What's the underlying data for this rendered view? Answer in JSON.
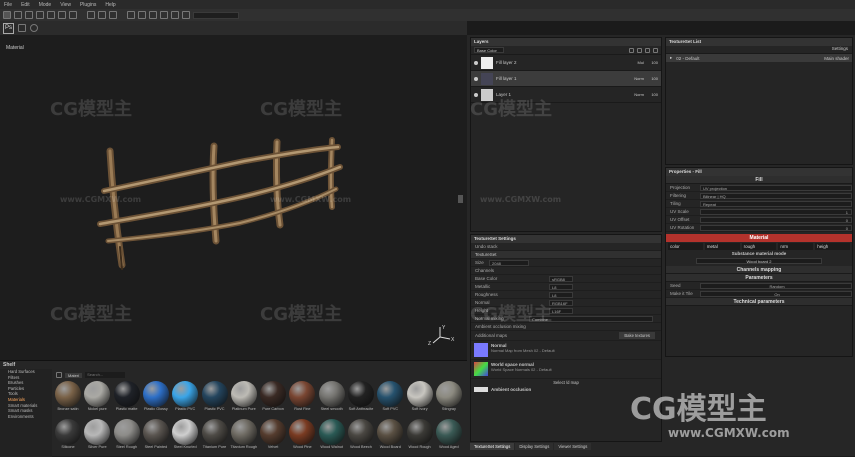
{
  "menu": [
    "File",
    "Edit",
    "Mode",
    "View",
    "Plugins",
    "Help"
  ],
  "viewport": {
    "label": "Material"
  },
  "layers": {
    "title": "Layers",
    "dropdown": "Base Color",
    "items": [
      {
        "name": "Fill layer 2",
        "blend": "Mul",
        "opacity": "100"
      },
      {
        "name": "Fill layer 1",
        "blend": "Norm",
        "opacity": "100"
      },
      {
        "name": "Layer 1",
        "blend": "Norm",
        "opacity": "100"
      }
    ]
  },
  "textureset_list": {
    "title": "TextureSet List",
    "settings": "Settings",
    "item": "02 - Default",
    "shader": "Main shader"
  },
  "properties": {
    "title": "Properties - Fill",
    "fill": "Fill",
    "projection_label": "Projection",
    "projection_value": "UV projection",
    "filtering_label": "Filtering",
    "filtering_value": "Bilinear | HQ",
    "tiling_label": "Tiling",
    "tiling_value": "Repeat",
    "uvscale_label": "UV Scale",
    "uvscale_value": "1",
    "uvoffset_label": "UV Offset",
    "uvoffset_value": "0",
    "uvrot_label": "UV Rotation",
    "uvrot_value": "0",
    "material": "Material",
    "channels": [
      "color",
      "metal",
      "rough",
      "nrm",
      "heigh"
    ],
    "mode_title": "Substance material mode",
    "mode_value": "Wood board 2",
    "mapping": "Channels mapping",
    "parameters": "Parameters",
    "param1_label": "Seed",
    "param1_value": "Random",
    "param2_label": "Make it Tile",
    "param2_value": "On",
    "technical": "Technical parameters"
  },
  "textureset_settings": {
    "title": "TextureSet Settings",
    "undo": "Undo stack",
    "name": "TextureSet",
    "size_label": "Size",
    "size_value": "2048",
    "channels_label": "Channels",
    "channels": [
      {
        "name": "Base Color",
        "fmt": "sRGB8"
      },
      {
        "name": "Metallic",
        "fmt": "L8"
      },
      {
        "name": "Roughness",
        "fmt": "L8"
      },
      {
        "name": "Normal",
        "fmt": "RGB16F"
      },
      {
        "name": "Height",
        "fmt": "L16F"
      }
    ],
    "normal_mixing_label": "Normal mixing",
    "normal_mixing_value": "Combine",
    "ao_label": "Ambient occlusion mixing",
    "maps_label": "Additional maps",
    "bake_button": "Bake textures",
    "maps": [
      {
        "title": "Normal",
        "sub": "Normal Map from Mesh 02 - Default"
      },
      {
        "title": "World space normal",
        "sub": "World Space Normals 02 - Default"
      },
      {
        "title": "Ambient occlusion",
        "sub": ""
      }
    ],
    "select_map": "Select /d map"
  },
  "bottom_tabs": [
    "TextureSet Settings",
    "Display Settings",
    "Viewer Settings"
  ],
  "shelf": {
    "title": "Shelf",
    "categories": [
      "Hard Surfaces",
      "Filters",
      "Brushes",
      "Particles",
      "Tools",
      "Materials",
      "Smart materials",
      "Smart masks",
      "Environments"
    ],
    "selected": "Materials",
    "filter_tag": "Materi",
    "search_placeholder": "Search...",
    "row1": [
      {
        "name": "Bronze satin",
        "c": "#7a6248"
      },
      {
        "name": "Nickel pure",
        "c": "#aaa9a4"
      },
      {
        "name": "Plastic matte",
        "c": "#1f2228"
      },
      {
        "name": "Plastic Glossy",
        "c": "#2d6fc7"
      },
      {
        "name": "Plastic PVC",
        "c": "#3aa5e8"
      },
      {
        "name": "Plastic PVC",
        "c": "#24455e"
      },
      {
        "name": "Platinum Pure",
        "c": "#bdbbb5"
      },
      {
        "name": "Pure Carbon",
        "c": "#3a2a24"
      },
      {
        "name": "Rust Fine",
        "c": "#7a4632"
      },
      {
        "name": "Steel smooth",
        "c": "#757470"
      },
      {
        "name": "Soft Anthracite",
        "c": "#222"
      },
      {
        "name": "Soft PVC",
        "c": "#26526e"
      },
      {
        "name": "Soft Ivory",
        "c": "#c8c6c0"
      },
      {
        "name": "Stingray",
        "c": "#8c8a80"
      }
    ],
    "row2": [
      {
        "name": "Silicone",
        "c": "#3a3a3a"
      },
      {
        "name": "Silver Pure",
        "c": "#b8b8b8"
      },
      {
        "name": "Steel Rough",
        "c": "#8d8c89"
      },
      {
        "name": "Steel Painted",
        "c": "#5a5550"
      },
      {
        "name": "Steel Knurled",
        "c": "#cfcfcf"
      },
      {
        "name": "Titanium Pure",
        "c": "#4e4b46"
      },
      {
        "name": "Titanium Rough",
        "c": "#6e6a62"
      },
      {
        "name": "Velvet",
        "c": "#553c2e"
      },
      {
        "name": "Wood Pine",
        "c": "#7a3b22"
      },
      {
        "name": "Wood Walnut",
        "c": "#2a5a55"
      },
      {
        "name": "Wood Beech",
        "c": "#4a4742"
      },
      {
        "name": "Wood Board",
        "c": "#5a5043"
      },
      {
        "name": "Wood Rough",
        "c": "#3b3a36"
      },
      {
        "name": "Wood Aged",
        "c": "#3a5a55"
      }
    ]
  },
  "watermarks": [
    "CG模型主",
    "www.CGMXW.com"
  ]
}
